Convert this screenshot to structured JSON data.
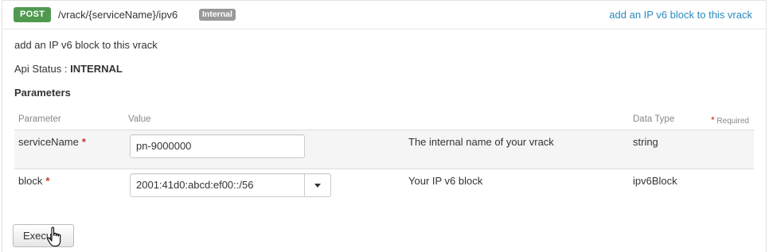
{
  "heading": {
    "method": "POST",
    "path": "/vrack/{serviceName}/ipv6",
    "status_badge": "Internal",
    "summary_link": "add an IP v6 block to this vrack"
  },
  "description": "add an IP v6 block to this vrack",
  "api_status": {
    "label": "Api Status : ",
    "value": "INTERNAL"
  },
  "parameters": {
    "title": "Parameters",
    "columns": {
      "parameter": "Parameter",
      "value": "Value",
      "data_type": "Data Type",
      "required_star": "*",
      "required_label": "Required"
    },
    "rows": [
      {
        "name": "serviceName",
        "required_star": "*",
        "value": "pn-9000000",
        "description": "The internal name of your vrack",
        "data_type": "string"
      },
      {
        "name": "block",
        "required_star": "*",
        "value": "2001:41d0:abcd:ef00::/56",
        "description": "Your IP v6 block",
        "data_type": "ipv6Block"
      }
    ]
  },
  "execute_label": "Execute",
  "colors": {
    "method_badge": "#4f9a4f",
    "status_badge": "#999999",
    "link": "#2a8abd",
    "required_star": "#c0392b"
  }
}
